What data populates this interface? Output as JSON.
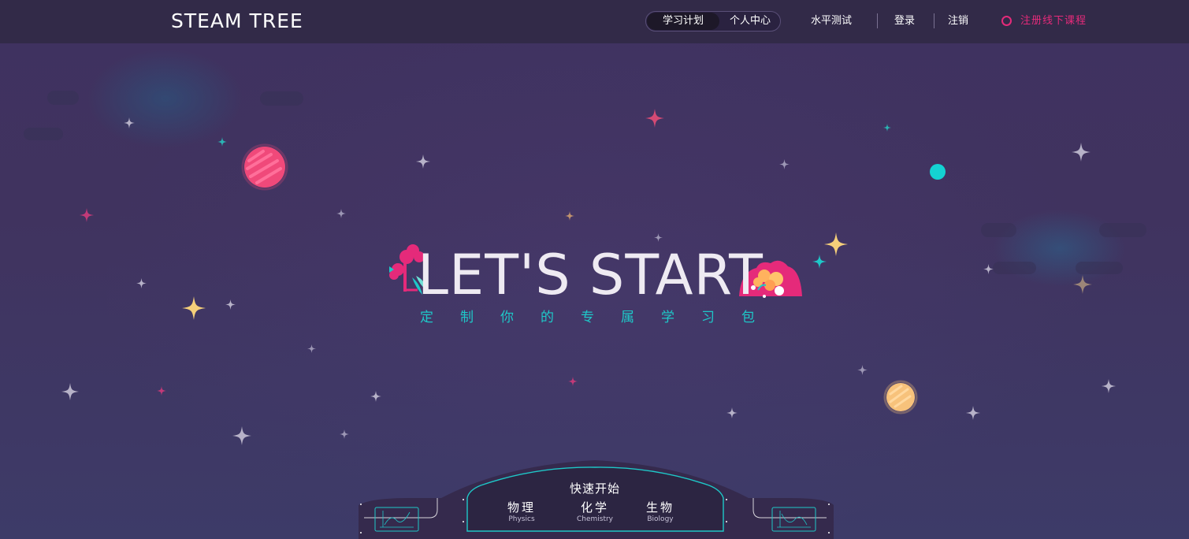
{
  "header": {
    "logo": "STEAM TREE",
    "tabs": [
      {
        "label": "学习计划",
        "active": true
      },
      {
        "label": "个人中心",
        "active": false
      }
    ],
    "level_test": "水平测试",
    "login": "登录",
    "logout": "注销",
    "register_offline": "注册线下课程"
  },
  "hero": {
    "title": "LET'S START",
    "subtitle": "定制你的专属学习包"
  },
  "quick_start": {
    "title": "快速开始",
    "subjects": [
      {
        "zh": "物理",
        "en": "Physics"
      },
      {
        "zh": "化学",
        "en": "Chemistry"
      },
      {
        "zh": "生物",
        "en": "Biology"
      }
    ]
  },
  "colors": {
    "background": "#40335f",
    "header": "#322a48",
    "accent_pink": "#e52a7a",
    "accent_teal": "#1ec8c8",
    "planet_pink": "#f0497a",
    "planet_teal": "#14d2d2",
    "planet_yellow": "#f7c27b"
  },
  "icons": [
    "star-icon",
    "sparkle-icon",
    "planet-icon",
    "flower-icon",
    "record-icon",
    "graph-icon"
  ]
}
